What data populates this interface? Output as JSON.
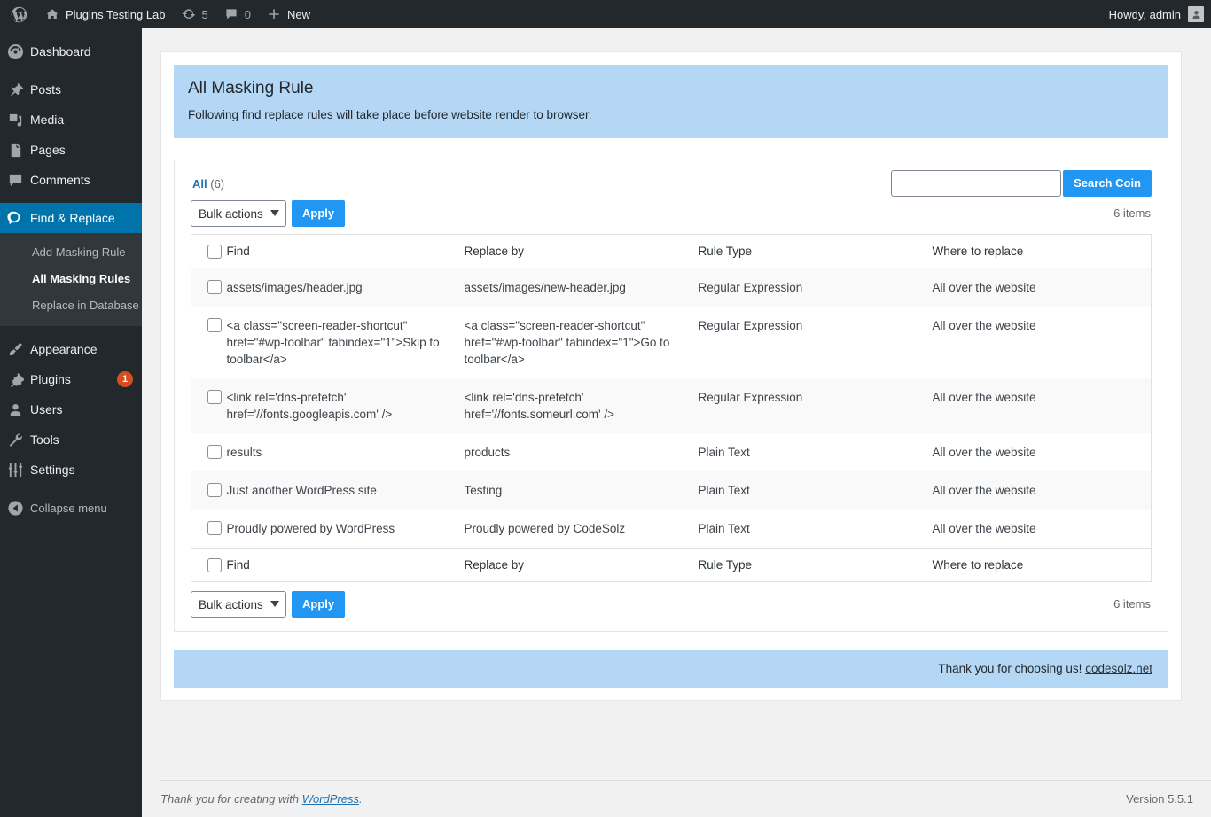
{
  "adminbar": {
    "logo_icon": "wordpress-logo-icon",
    "site_name": "Plugins Testing Lab",
    "site_icon": "home-icon",
    "updates_icon": "update-arrows-icon",
    "updates_count": "5",
    "comments_icon": "comment-bubble-icon",
    "comments_count": "0",
    "new_icon": "plus-icon",
    "new_label": "New",
    "howdy": "Howdy, admin",
    "avatar_icon": "user-avatar-icon"
  },
  "sidebar": {
    "items": [
      {
        "label": "Dashboard",
        "icon": "dashboard-gauge-icon",
        "current": false
      },
      {
        "label": "Posts",
        "icon": "pin-icon",
        "current": false
      },
      {
        "label": "Media",
        "icon": "media-icon",
        "current": false
      },
      {
        "label": "Pages",
        "icon": "pages-icon",
        "current": false
      },
      {
        "label": "Comments",
        "icon": "comment-bubble-icon",
        "current": false
      },
      {
        "label": "Find & Replace",
        "icon": "search-replace-icon",
        "current": true
      },
      {
        "label": "Appearance",
        "icon": "paintbrush-icon",
        "current": false
      },
      {
        "label": "Plugins",
        "icon": "plug-icon",
        "current": false,
        "badge": "1"
      },
      {
        "label": "Users",
        "icon": "user-icon",
        "current": false
      },
      {
        "label": "Tools",
        "icon": "wrench-icon",
        "current": false
      },
      {
        "label": "Settings",
        "icon": "sliders-icon",
        "current": false
      }
    ],
    "submenu": [
      {
        "label": "Add Masking Rule",
        "current": false
      },
      {
        "label": "All Masking Rules",
        "current": true
      },
      {
        "label": "Replace in Database",
        "current": false
      }
    ],
    "collapse": {
      "label": "Collapse menu",
      "icon": "collapse-arrow-icon"
    }
  },
  "notice": {
    "title": "All Masking Rule",
    "subtitle": "Following find replace rules will take place before website render to browser."
  },
  "toolbar": {
    "filter_all_label": "All",
    "filter_all_count": "(6)",
    "search_value": "",
    "search_placeholder": "",
    "search_button_label": "Search Coin",
    "bulk_actions_label": "Bulk actions",
    "apply_label": "Apply",
    "items_count": "6 items"
  },
  "table": {
    "columns": [
      "Find",
      "Replace by",
      "Rule Type",
      "Where to replace"
    ],
    "rows": [
      {
        "find": "assets/images/header.jpg",
        "replace": "assets/images/new-header.jpg",
        "type": "Regular Expression",
        "where": "All over the website"
      },
      {
        "find": "<a class=\"screen-reader-shortcut\" href=\"#wp-toolbar\" tabindex=\"1\">Skip to toolbar</a>",
        "replace": "<a class=\"screen-reader-shortcut\" href=\"#wp-toolbar\" tabindex=\"1\">Go to toolbar</a>",
        "type": "Regular Expression",
        "where": "All over the website"
      },
      {
        "find": "<link rel='dns-prefetch' href='//fonts.googleapis.com' />",
        "replace": "<link rel='dns-prefetch' href='//fonts.someurl.com' />",
        "type": "Regular Expression",
        "where": "All over the website"
      },
      {
        "find": "results",
        "replace": "products",
        "type": "Plain Text",
        "where": "All over the website"
      },
      {
        "find": "Just another WordPress site",
        "replace": "Testing",
        "type": "Plain Text",
        "where": "All over the website"
      },
      {
        "find": "Proudly powered by WordPress",
        "replace": "Proudly powered by CodeSolz",
        "type": "Plain Text",
        "where": "All over the website"
      }
    ]
  },
  "thanks": {
    "text": "Thank you for choosing us!",
    "link": "codesolz.net"
  },
  "footer": {
    "text_prefix": "Thank you for creating with ",
    "link": "WordPress",
    "text_suffix": ".",
    "version": "Version 5.5.1"
  },
  "colors": {
    "adminbar_bg": "#23282d",
    "sidebar_bg": "#23282d",
    "submenu_bg": "#32373c",
    "accent_current": "#0073aa",
    "button_primary": "#2196f3",
    "notice_bg": "#b3d7f5",
    "badge_bg": "#d54e21",
    "link": "#2271b1"
  }
}
